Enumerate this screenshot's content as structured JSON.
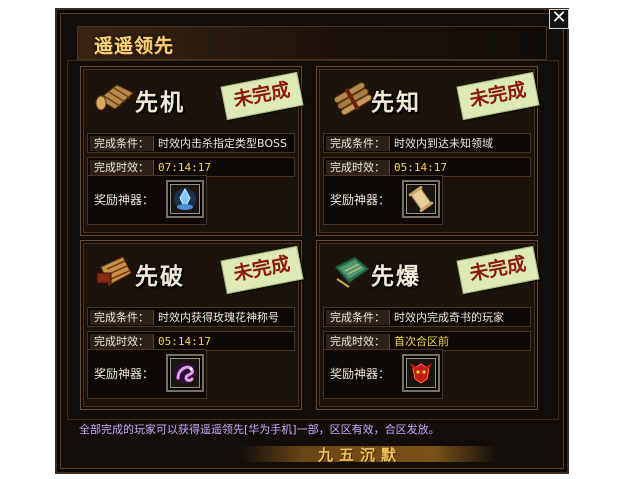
{
  "title": "遥遥领先",
  "close_glyph": "✕",
  "cards": [
    {
      "name": "先机",
      "status": "未完成",
      "condition_label": "完成条件：",
      "condition": "时效内击杀指定类型BOSS",
      "time_label": "完成时效：",
      "time": "07:14:17",
      "reward_label": "奖励神器：",
      "reward_icon": "blue-crystal-icon",
      "category_icon": "bamboo-scroll-icon"
    },
    {
      "name": "先知",
      "status": "未完成",
      "condition_label": "完成条件：",
      "condition": "时效内到达未知领域",
      "time_label": "完成时效：",
      "time": "05:14:17",
      "reward_label": "奖励神器：",
      "reward_icon": "parchment-scroll-icon",
      "category_icon": "bamboo-bundle-icon"
    },
    {
      "name": "先破",
      "status": "未完成",
      "condition_label": "完成条件：",
      "condition": "时效内获得玫瑰花神称号",
      "time_label": "完成时效：",
      "time": "05:14:17",
      "reward_label": "奖励神器：",
      "reward_icon": "purple-dragon-icon",
      "category_icon": "open-scroll-icon"
    },
    {
      "name": "先爆",
      "status": "未完成",
      "condition_label": "完成条件：",
      "condition": "时效内完成奇书的玩家",
      "time_label": "完成时效：",
      "time": "首次合区前",
      "reward_label": "奖励神器：",
      "reward_icon": "red-demon-mask-icon",
      "category_icon": "jade-book-icon"
    }
  ],
  "footer_text": "全部完成的玩家可以获得遥遥领先[华为手机]一部，区区有效，合区发放。",
  "brand": "九五沉默",
  "colors": {
    "title": "#f3d37a",
    "badge_bg": "#dde9b7",
    "badge_text": "#8a1a0d",
    "timer": "#f6d34a",
    "footer_text": "#c8a8ff"
  }
}
